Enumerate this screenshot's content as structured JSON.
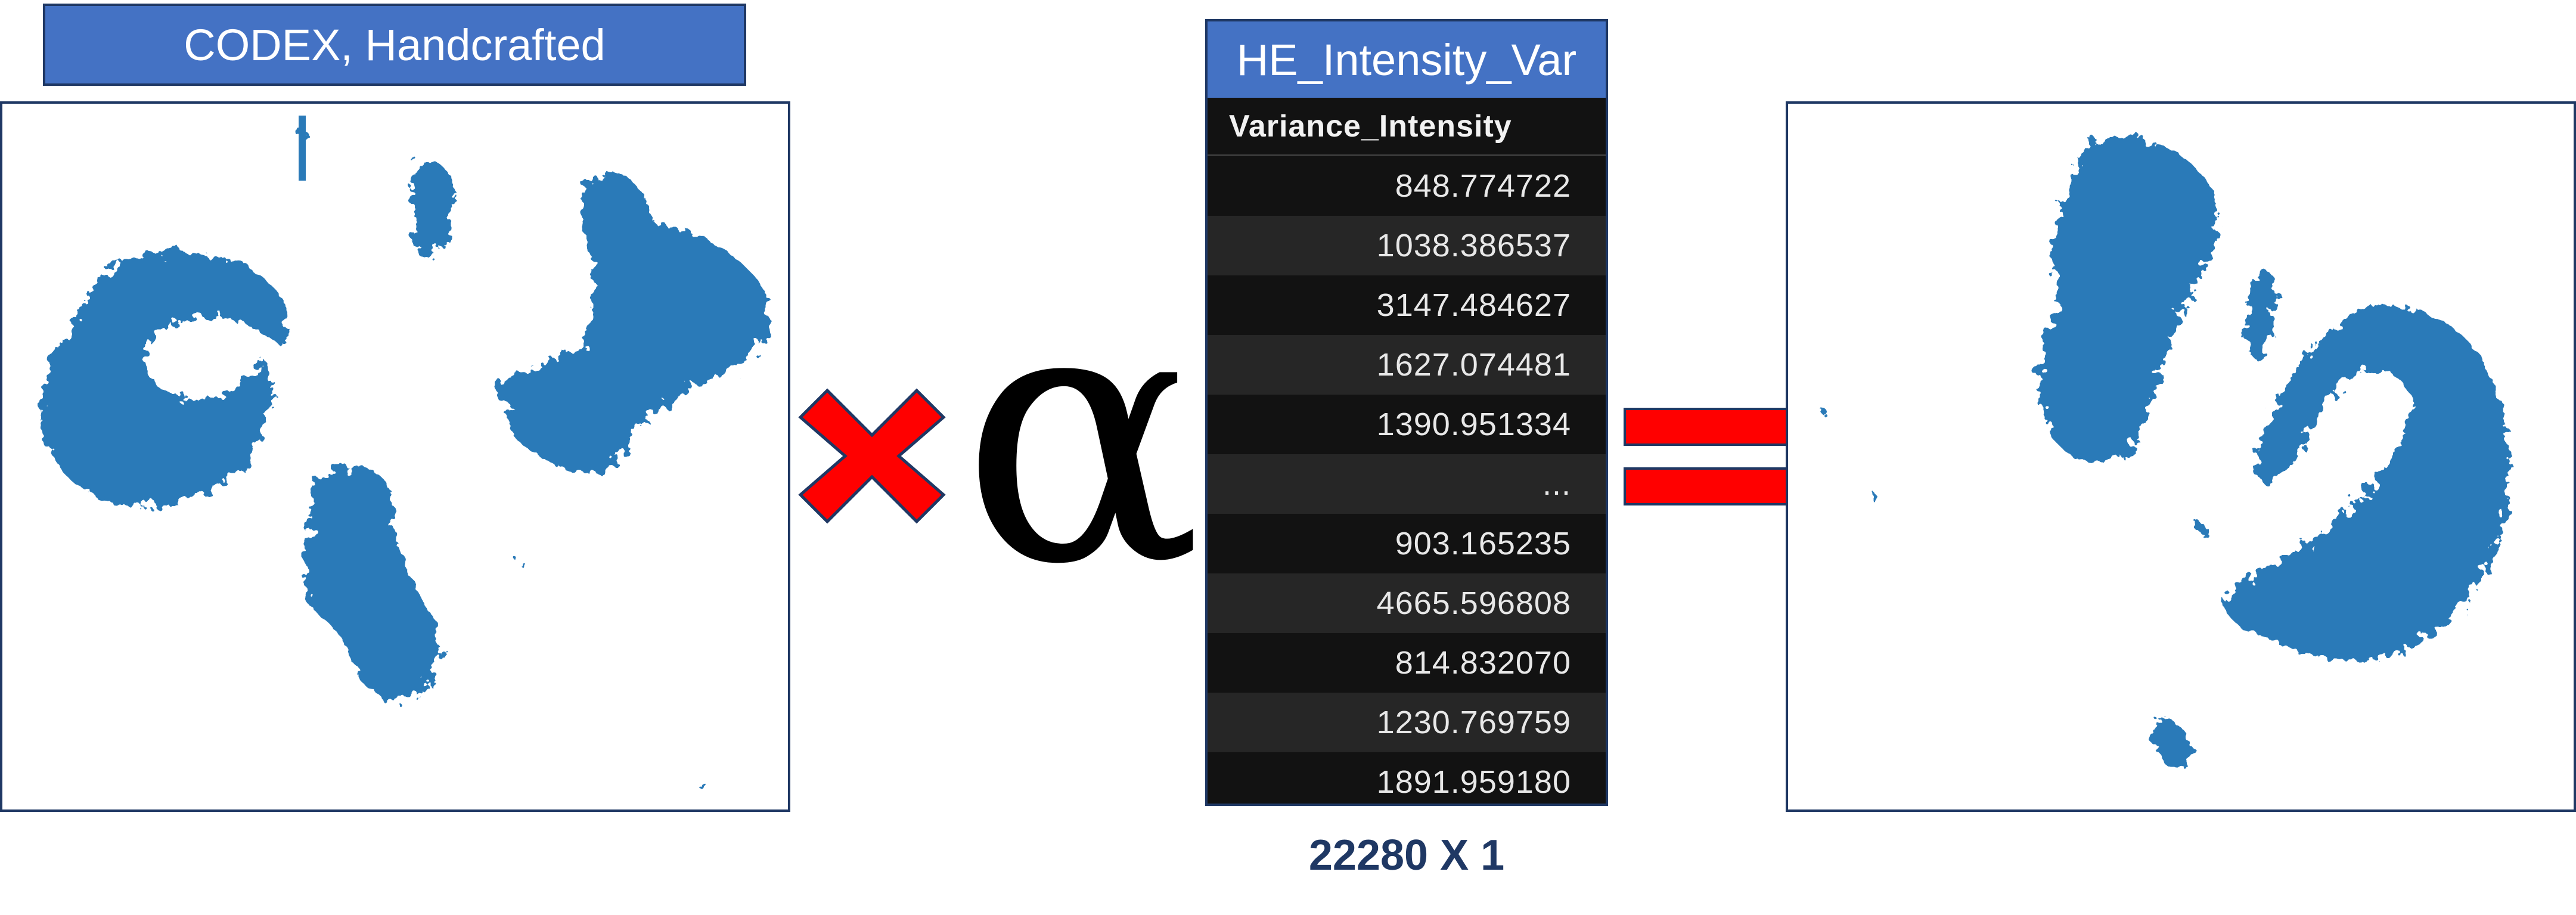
{
  "left_title": "CODEX, Handcrafted",
  "operators": {
    "times_icon": "multiply-cross-icon",
    "alpha": "α",
    "equals_icon": "equals-icon"
  },
  "table": {
    "title": "HE_Intensity_Var",
    "header": "Variance_Intensity",
    "rows": [
      "848.774722",
      "1038.386537",
      "3147.484627",
      "1627.074481",
      "1390.951334",
      "...",
      "903.165235",
      "4665.596808",
      "814.832070",
      "1230.769759",
      "1891.959180"
    ]
  },
  "dims": "22280 X  1",
  "colors": {
    "title_bg": "#4472c4",
    "border": "#1f3864",
    "point": "#2a7ab8",
    "operator_red": "#ff0000",
    "table_bg": "#121212",
    "table_row_alt": "#262626",
    "dims_text": "#1f3864"
  }
}
